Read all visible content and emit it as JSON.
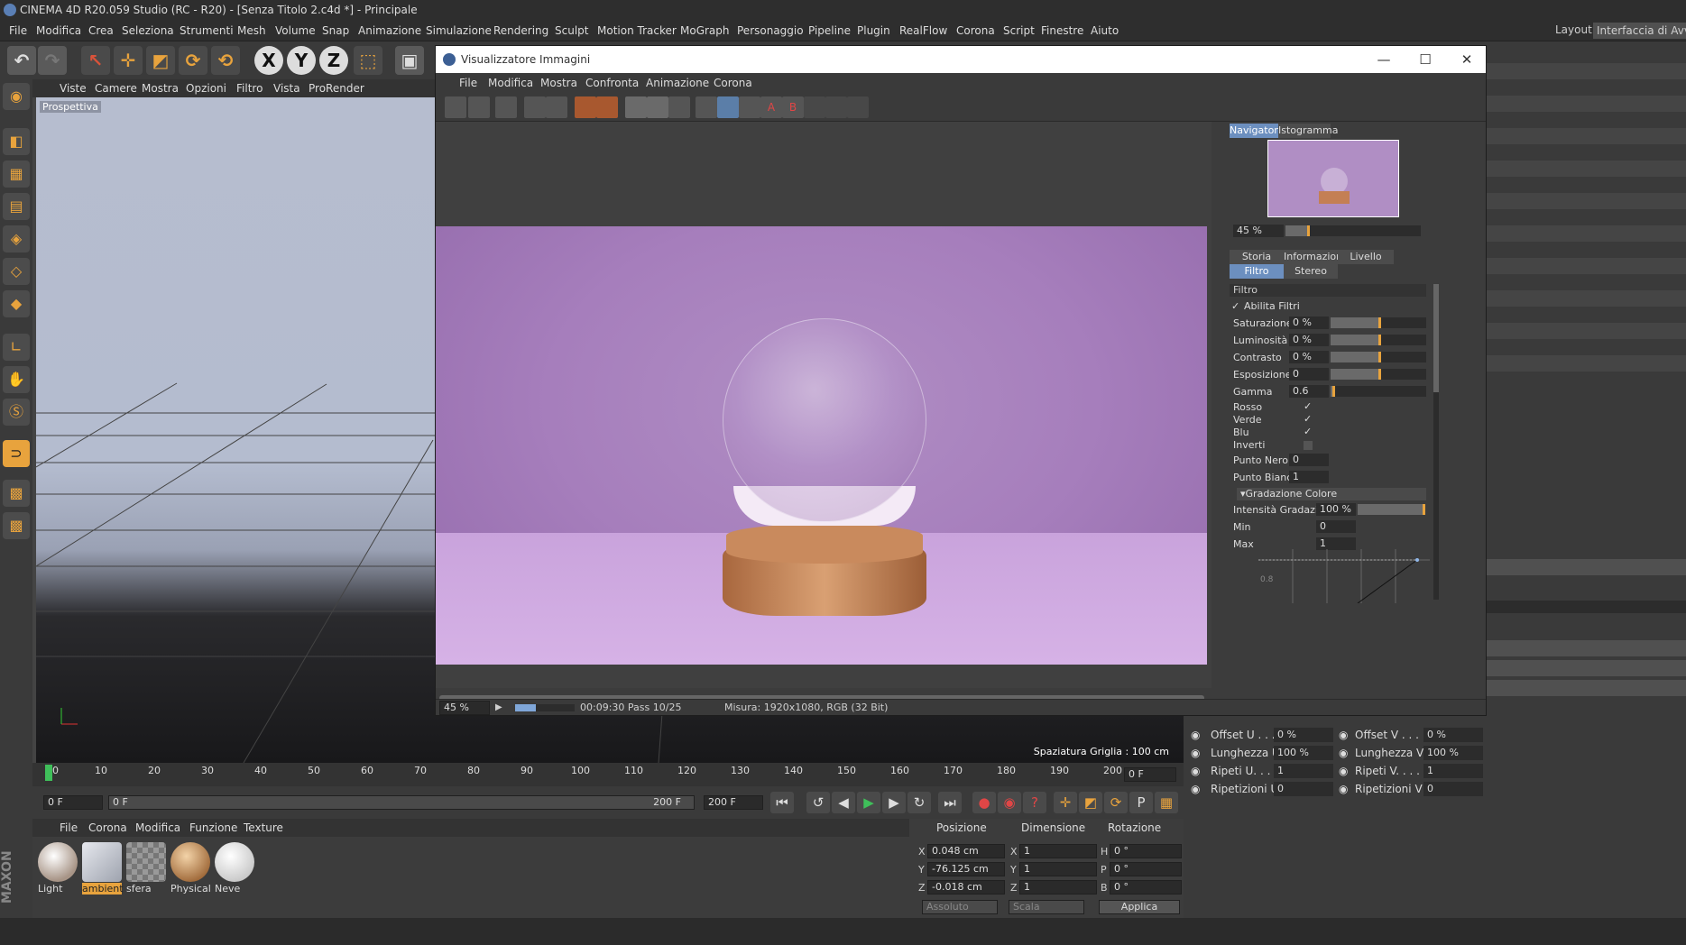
{
  "window": {
    "title": "CINEMA 4D R20.059 Studio (RC - R20) - [Senza Titolo 2.c4d *] - Principale"
  },
  "menu": [
    "File",
    "Modifica",
    "Crea",
    "Seleziona",
    "Strumenti",
    "Mesh",
    "Volume",
    "Snap",
    "Animazione",
    "Simulazione",
    "Rendering",
    "Sculpt",
    "Motion Tracker",
    "MoGraph",
    "Personaggio",
    "Pipeline",
    "Plugin",
    "RealFlow",
    "Corona",
    "Script",
    "Finestre",
    "Aiuto"
  ],
  "layout": {
    "label": "Layout:",
    "value": "Interfaccia di Avvio"
  },
  "viewport": {
    "menu": [
      "Viste",
      "Camere",
      "Mostra",
      "Opzioni",
      "Filtro",
      "Vista",
      "ProRender"
    ],
    "label": "Prospettiva",
    "grid_spacing": "Spaziatura Griglia : 100 cm"
  },
  "timeline": {
    "ticks": [
      "0",
      "10",
      "20",
      "30",
      "40",
      "50",
      "60",
      "70",
      "80",
      "90",
      "100",
      "110",
      "120",
      "130",
      "140",
      "150",
      "160",
      "170",
      "180",
      "190",
      "200"
    ],
    "frame": "0 F"
  },
  "transport": {
    "start": "0 F",
    "range_start": "0 F",
    "range_end": "200 F",
    "end": "200 F"
  },
  "materials": {
    "menu": [
      "File",
      "Corona",
      "Modifica",
      "Funzione",
      "Texture"
    ],
    "items": [
      {
        "name": "Light",
        "color": "#d9d0c8"
      },
      {
        "name": "ambient",
        "color": "#c9ccd2"
      },
      {
        "name": "sfera",
        "color": "#8a8a8a"
      },
      {
        "name": "Physical",
        "color": "#d6a875"
      },
      {
        "name": "Neve",
        "color": "#f2f2f2"
      }
    ]
  },
  "coords": {
    "headers": [
      "Posizione",
      "Dimensione",
      "Rotazione"
    ],
    "rows": [
      {
        "axis": "X",
        "pos": "0.048 cm",
        "dimaxis": "X",
        "dim": "1",
        "rotaxis": "H",
        "rot": "0 °"
      },
      {
        "axis": "Y",
        "pos": "-76.125 cm",
        "dimaxis": "Y",
        "dim": "1",
        "rotaxis": "P",
        "rot": "0 °"
      },
      {
        "axis": "Z",
        "pos": "-0.018 cm",
        "dimaxis": "Z",
        "dim": "1",
        "rotaxis": "B",
        "rot": "0 °"
      }
    ],
    "mode": "Assoluto",
    "scale": "Scala",
    "apply": "Applica"
  },
  "texprops": [
    {
      "l": "Offset U . . .",
      "v": "0 %",
      "l2": "Offset V . . .",
      "v2": "0 %"
    },
    {
      "l": "Lunghezza U",
      "v": "100 %",
      "l2": "Lunghezza V",
      "v2": "100 %"
    },
    {
      "l": "Ripeti U. . . .",
      "v": "1",
      "l2": "Ripeti V. . . .",
      "v2": "1"
    },
    {
      "l": "Ripetizioni U",
      "v": "0",
      "l2": "Ripetizioni V",
      "v2": "0"
    }
  ],
  "viewer": {
    "title": "Visualizzatore Immagini",
    "menu": [
      "File",
      "Modifica",
      "Mostra",
      "Confronta",
      "Animazione",
      "Corona"
    ],
    "zoom": "45 %",
    "progress_fraction": 0.35,
    "time": "00:09:30 Pass 10/25",
    "size": "Misura: 1920x1080, RGB (32 Bit)",
    "nav_tabs": [
      "Navigatore",
      "Istogramma"
    ],
    "nav_zoom": "45 %",
    "tabs_row1": [
      "Storia",
      "Informazioni",
      "Livello"
    ],
    "tabs_row2": [
      "Filtro",
      "Stereo"
    ],
    "filter": {
      "section": "Filtro",
      "enable": "Abilita Filtri",
      "sliders": [
        {
          "label": "Saturazione",
          "value": "0 %",
          "fraction": 0.5
        },
        {
          "label": "Luminosità",
          "value": "0 %",
          "fraction": 0.5
        },
        {
          "label": "Contrasto",
          "value": "0 %",
          "fraction": 0.5
        },
        {
          "label": "Esposizione",
          "value": "0",
          "fraction": 0.5
        },
        {
          "label": "Gamma",
          "value": "0.6",
          "fraction": 0.02
        }
      ],
      "channels": [
        "Rosso",
        "Verde",
        "Blu",
        "Inverti"
      ],
      "black": {
        "label": "Punto Nero",
        "value": "0"
      },
      "white": {
        "label": "Punto Bianco",
        "value": "1"
      },
      "gradation": "Gradazione Colore",
      "intensity": {
        "label": "Intensità Gradazione",
        "value": "100 %"
      },
      "min": {
        "label": "Min",
        "value": "0"
      },
      "max": {
        "label": "Max",
        "value": "1"
      },
      "curve_label": "0.8"
    }
  },
  "colors": {
    "accent": "#e8a33d",
    "selected_tab": "#6c8fbf"
  }
}
